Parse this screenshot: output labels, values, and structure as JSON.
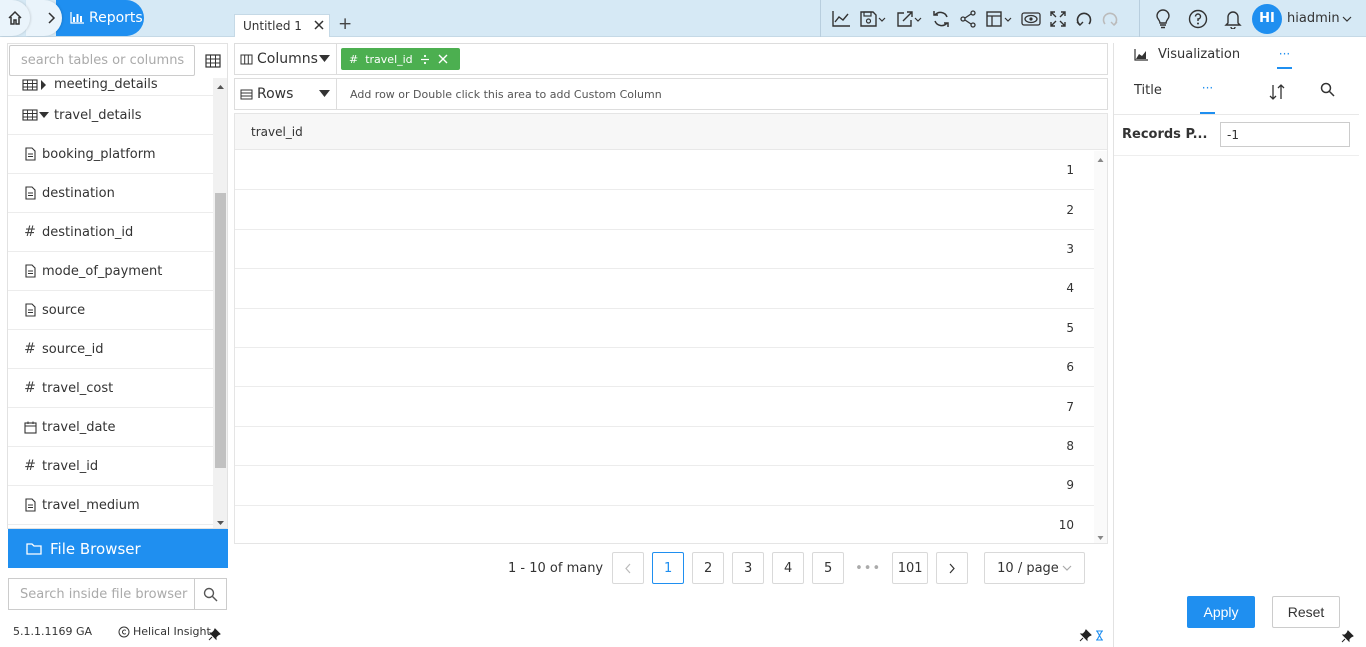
{
  "header": {
    "reports_label": "Reports",
    "tab_title": "Untitled 1",
    "username": "hiadmin",
    "avatar_initials": "HI"
  },
  "left": {
    "search_placeholder": "search tables or columns",
    "items": [
      {
        "label": "meeting_details",
        "icon": "table-icon"
      },
      {
        "label": "travel_details",
        "icon": "table-icon"
      },
      {
        "label": "booking_platform",
        "icon": "text-field-icon"
      },
      {
        "label": "destination",
        "icon": "text-field-icon"
      },
      {
        "label": "destination_id",
        "icon": "number-field-icon"
      },
      {
        "label": "mode_of_payment",
        "icon": "text-field-icon"
      },
      {
        "label": "source",
        "icon": "text-field-icon"
      },
      {
        "label": "source_id",
        "icon": "number-field-icon"
      },
      {
        "label": "travel_cost",
        "icon": "number-field-icon"
      },
      {
        "label": "travel_date",
        "icon": "date-field-icon"
      },
      {
        "label": "travel_id",
        "icon": "number-field-icon"
      },
      {
        "label": "travel_medium",
        "icon": "text-field-icon"
      }
    ],
    "file_browser_label": "File Browser",
    "file_search_placeholder": "Search inside file browser",
    "version": "5.1.1.1169 GA",
    "brand": "Helical Insight"
  },
  "center": {
    "columns_label": "Columns",
    "rows_label": "Rows",
    "column_pill": "travel_id",
    "rows_hint": "Add row or Double click this area to add Custom Column",
    "grid_header": "travel_id",
    "grid_values": [
      "1",
      "2",
      "3",
      "4",
      "5",
      "6",
      "7",
      "8",
      "9",
      "10"
    ],
    "pager_info": "1 - 10 of many",
    "pages": [
      "1",
      "2",
      "3",
      "4",
      "5",
      "•••",
      "101"
    ],
    "page_size": "10 / page"
  },
  "right": {
    "visualization_label": "Visualization",
    "dots_label": "···",
    "title_tab": "Title",
    "records_label": "Records P...",
    "records_value": "-1",
    "apply_label": "Apply",
    "reset_label": "Reset"
  },
  "colors": {
    "accent": "#1f8ff0",
    "pill": "#4caf50",
    "header_bg": "#d6e9f5"
  }
}
